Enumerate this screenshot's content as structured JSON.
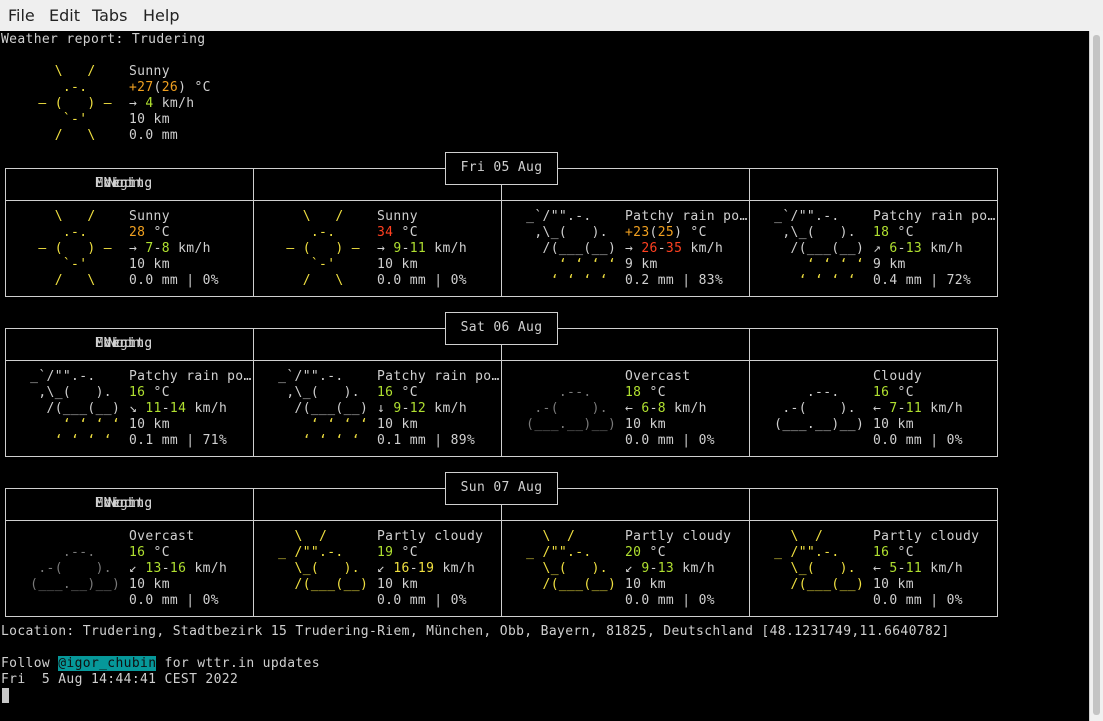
{
  "menu": {
    "file": "File",
    "edit": "Edit",
    "tabs": "Tabs",
    "help": "Help"
  },
  "report_title": "Weather report: Trudering",
  "current": {
    "art": [
      "    \\   /    ",
      "     .-.     ",
      "  ― (   ) ―  ",
      "     `-'     ",
      "    /   \\    "
    ],
    "condition": "Sunny",
    "temp": "+27",
    "feels": "26",
    "unit": " °C",
    "wind_arrow": "→",
    "wind": "4",
    "wind_unit": " km/h",
    "visibility": "10 km",
    "precip": "0.0 mm"
  },
  "days": [
    {
      "date": "Fri 05 Aug",
      "periods": [
        {
          "label": "Morning",
          "art_class": "y",
          "art": [
            "    \\   /    ",
            "     .-.     ",
            "  ― (   ) ―  ",
            "     `-'     ",
            "    /   \\    "
          ],
          "condition": "Sunny",
          "temp": "28",
          "temp_class": "o",
          "temp2": "",
          "wind_arrow": "→",
          "wind_a": "7",
          "wind_b": "8",
          "wind_class_a": "g",
          "wind_class_b": "g",
          "visibility": "10 km",
          "precip": "0.0 mm | 0%"
        },
        {
          "label": "Noon",
          "art_class": "y",
          "art": [
            "    \\   /    ",
            "     .-.     ",
            "  ― (   ) ―  ",
            "     `-'     ",
            "    /   \\    "
          ],
          "condition": "Sunny",
          "temp": "34",
          "temp_class": "r",
          "temp2": "",
          "wind_arrow": "→",
          "wind_a": "9",
          "wind_b": "11",
          "wind_class_a": "g",
          "wind_class_b": "g",
          "visibility": "10 km",
          "precip": "0.0 mm | 0%"
        },
        {
          "label": "Evening",
          "art_class": "rain",
          "art": [
            " _`/\"\".-.    ",
            "  ,\\_(   ).  ",
            "   /(___(__) ",
            "     ‘ ‘ ‘ ‘ ",
            "    ‘ ‘ ‘ ‘  "
          ],
          "condition": "Patchy rain po…",
          "temp": "+23",
          "temp_class": "o",
          "temp2": "25",
          "wind_arrow": "→",
          "wind_a": "26",
          "wind_b": "35",
          "wind_class_a": "r",
          "wind_class_b": "r",
          "visibility": "9 km",
          "precip": "0.2 mm | 83%"
        },
        {
          "label": "Night",
          "art_class": "rain",
          "art": [
            " _`/\"\".-.    ",
            "  ,\\_(   ).  ",
            "   /(___(__) ",
            "     ‘ ‘ ‘ ‘ ",
            "    ‘ ‘ ‘ ‘  "
          ],
          "condition": "Patchy rain po…",
          "temp": "18",
          "temp_class": "g",
          "temp2": "",
          "wind_arrow": "↗",
          "wind_a": "6",
          "wind_b": "13",
          "wind_class_a": "g",
          "wind_class_b": "g",
          "visibility": "9 km",
          "precip": "0.4 mm | 72%"
        }
      ]
    },
    {
      "date": "Sat 06 Aug",
      "periods": [
        {
          "label": "Morning",
          "art_class": "rain",
          "art": [
            " _`/\"\".-.    ",
            "  ,\\_(   ).  ",
            "   /(___(__) ",
            "     ‘ ‘ ‘ ‘ ",
            "    ‘ ‘ ‘ ‘  "
          ],
          "condition": "Patchy rain po…",
          "temp": "16",
          "temp_class": "g",
          "temp2": "",
          "wind_arrow": "↘",
          "wind_a": "11",
          "wind_b": "14",
          "wind_class_a": "g",
          "wind_class_b": "g",
          "visibility": "10 km",
          "precip": "0.1 mm | 71%"
        },
        {
          "label": "Noon",
          "art_class": "rain",
          "art": [
            " _`/\"\".-.    ",
            "  ,\\_(   ).  ",
            "   /(___(__) ",
            "     ‘ ‘ ‘ ‘ ",
            "    ‘ ‘ ‘ ‘  "
          ],
          "condition": "Patchy rain po…",
          "temp": "16",
          "temp_class": "g",
          "temp2": "",
          "wind_arrow": "↓",
          "wind_a": "9",
          "wind_b": "12",
          "wind_class_a": "g",
          "wind_class_b": "g",
          "visibility": "10 km",
          "precip": "0.1 mm | 89%"
        },
        {
          "label": "Evening",
          "art_class": "gr",
          "art": [
            "             ",
            "     .--.    ",
            "  .-(    ).  ",
            " (___.__)__) ",
            "             "
          ],
          "condition": "Overcast",
          "temp": "18",
          "temp_class": "g",
          "temp2": "",
          "wind_arrow": "←",
          "wind_a": "6",
          "wind_b": "8",
          "wind_class_a": "g",
          "wind_class_b": "g",
          "visibility": "10 km",
          "precip": "0.0 mm | 0%"
        },
        {
          "label": "Night",
          "art_class": "w",
          "art": [
            "             ",
            "     .--.    ",
            "  .-(    ).  ",
            " (___.__)__) ",
            "             "
          ],
          "condition": "Cloudy",
          "temp": "16",
          "temp_class": "g",
          "temp2": "",
          "wind_arrow": "←",
          "wind_a": "7",
          "wind_b": "11",
          "wind_class_a": "g",
          "wind_class_b": "g",
          "visibility": "10 km",
          "precip": "0.0 mm | 0%"
        }
      ]
    },
    {
      "date": "Sun 07 Aug",
      "periods": [
        {
          "label": "Morning",
          "art_class": "gr",
          "art": [
            "             ",
            "     .--.    ",
            "  .-(    ).  ",
            " (___.__)__) ",
            "             "
          ],
          "condition": "Overcast",
          "temp": "16",
          "temp_class": "g",
          "temp2": "",
          "wind_arrow": "↙",
          "wind_a": "13",
          "wind_b": "16",
          "wind_class_a": "g",
          "wind_class_b": "g",
          "visibility": "10 km",
          "precip": "0.0 mm | 0%"
        },
        {
          "label": "Noon",
          "art_class": "pc",
          "art": [
            "   \\  /      ",
            " _ /\"\".-.    ",
            "   \\_(   ).  ",
            "   /(___(__) ",
            "             "
          ],
          "condition": "Partly cloudy",
          "temp": "19",
          "temp_class": "g",
          "temp2": "",
          "wind_arrow": "↙",
          "wind_a": "16",
          "wind_b": "19",
          "wind_class_a": "y",
          "wind_class_b": "y",
          "visibility": "10 km",
          "precip": "0.0 mm | 0%"
        },
        {
          "label": "Evening",
          "art_class": "pc",
          "art": [
            "   \\  /      ",
            " _ /\"\".-.    ",
            "   \\_(   ).  ",
            "   /(___(__) ",
            "             "
          ],
          "condition": "Partly cloudy",
          "temp": "20",
          "temp_class": "g",
          "temp2": "",
          "wind_arrow": "↙",
          "wind_a": "9",
          "wind_b": "13",
          "wind_class_a": "g",
          "wind_class_b": "g",
          "visibility": "10 km",
          "precip": "0.0 mm | 0%"
        },
        {
          "label": "Night",
          "art_class": "pc",
          "art": [
            "   \\  /      ",
            " _ /\"\".-.    ",
            "   \\_(   ).  ",
            "   /(___(__) ",
            "             "
          ],
          "condition": "Partly cloudy",
          "temp": "16",
          "temp_class": "g",
          "temp2": "",
          "wind_arrow": "←",
          "wind_a": "5",
          "wind_b": "11",
          "wind_class_a": "g",
          "wind_class_b": "g",
          "visibility": "10 km",
          "precip": "0.0 mm | 0%"
        }
      ]
    }
  ],
  "location": "Location: Trudering, Stadtbezirk 15 Trudering-Riem, München, Obb, Bayern, 81825, Deutschland [48.1231749,11.6640782]",
  "follow_prefix": "Follow ",
  "follow_handle": "@igor_chubin",
  "follow_suffix": " for wttr.in updates",
  "timestamp": "Fri  5 Aug 14:44:41 CEST 2022",
  "colors": {
    "terminal_bg": "#000000",
    "sun": "#f0e040",
    "temp_orange": "#f0a020",
    "temp_red": "#ff4020",
    "green": "#b0e030",
    "link_bg": "#06989a"
  }
}
